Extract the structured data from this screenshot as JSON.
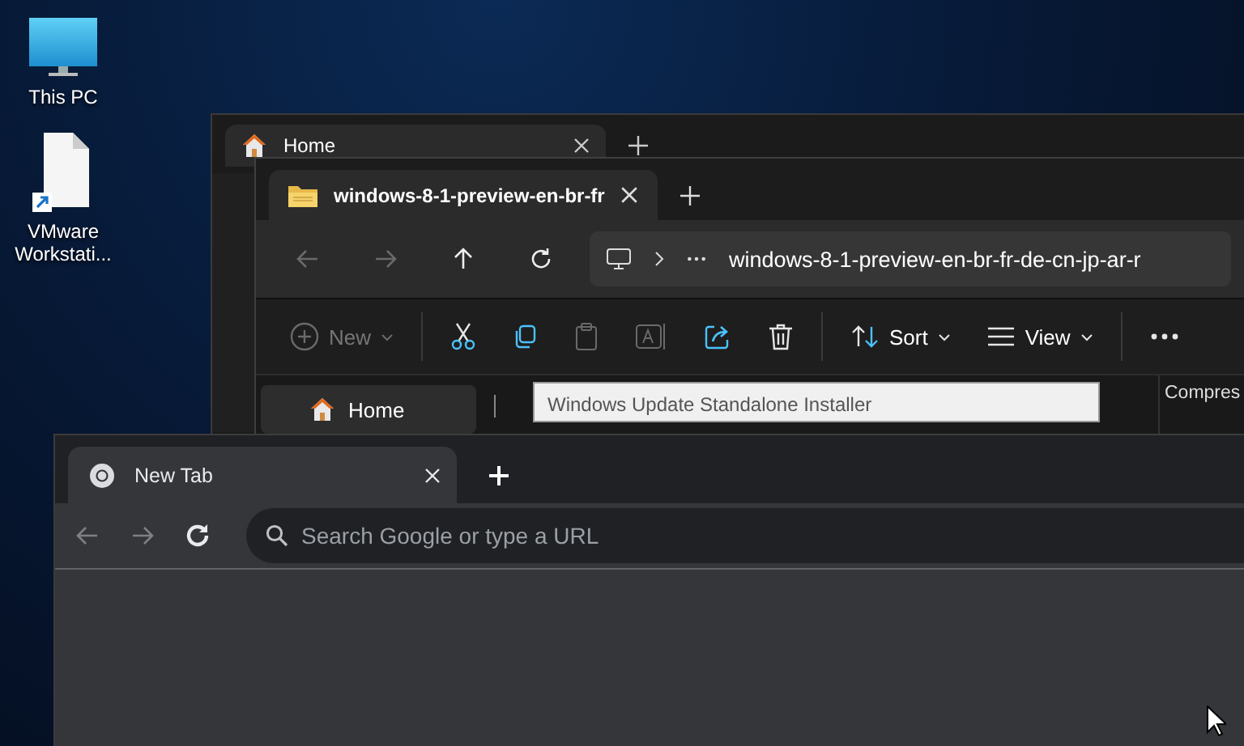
{
  "desktop": {
    "icons": [
      {
        "kind": "monitor",
        "label": "This PC"
      },
      {
        "kind": "shortcut",
        "label": "VMware Workstati..."
      }
    ]
  },
  "back_explorer": {
    "tabs": [
      {
        "label": "Home",
        "selected": true
      }
    ]
  },
  "explorer": {
    "tabs": [
      {
        "label": "windows-8-1-preview-en-br-fr",
        "selected": true
      }
    ],
    "nav": [
      {
        "kind": "back",
        "disabled": true
      },
      {
        "kind": "forward",
        "disabled": true
      },
      {
        "kind": "up",
        "disabled": false
      },
      {
        "kind": "refresh",
        "disabled": false
      }
    ],
    "address": {
      "path": "windows-8-1-preview-en-br-fr-de-cn-jp-ar-r"
    },
    "toolbar": [
      {
        "kind": "new",
        "label": "New",
        "disabled": true
      },
      {
        "kind": "separator"
      },
      {
        "kind": "cut",
        "disabled": false
      },
      {
        "kind": "copy",
        "disabled": false
      },
      {
        "kind": "paste",
        "disabled": true
      },
      {
        "kind": "rename",
        "disabled": true
      },
      {
        "kind": "share",
        "disabled": false
      },
      {
        "kind": "delete",
        "disabled": false
      },
      {
        "kind": "separator"
      },
      {
        "kind": "sort",
        "label": "Sort",
        "disabled": false
      },
      {
        "kind": "view",
        "label": "View",
        "disabled": false
      },
      {
        "kind": "separator"
      },
      {
        "kind": "more",
        "disabled": false
      }
    ],
    "sidebar": [
      {
        "label": "Home",
        "selected": true
      }
    ],
    "tooltip": "Windows Update Standalone Installer",
    "columns": [
      {
        "label": "Compres"
      }
    ]
  },
  "chrome": {
    "tabs": [
      {
        "label": "New Tab",
        "selected": true
      }
    ],
    "nav": [
      {
        "kind": "back",
        "disabled": true
      },
      {
        "kind": "forward",
        "disabled": true
      },
      {
        "kind": "reload",
        "disabled": false
      }
    ],
    "omnibox": {
      "placeholder": "Search Google or type a URL"
    }
  }
}
